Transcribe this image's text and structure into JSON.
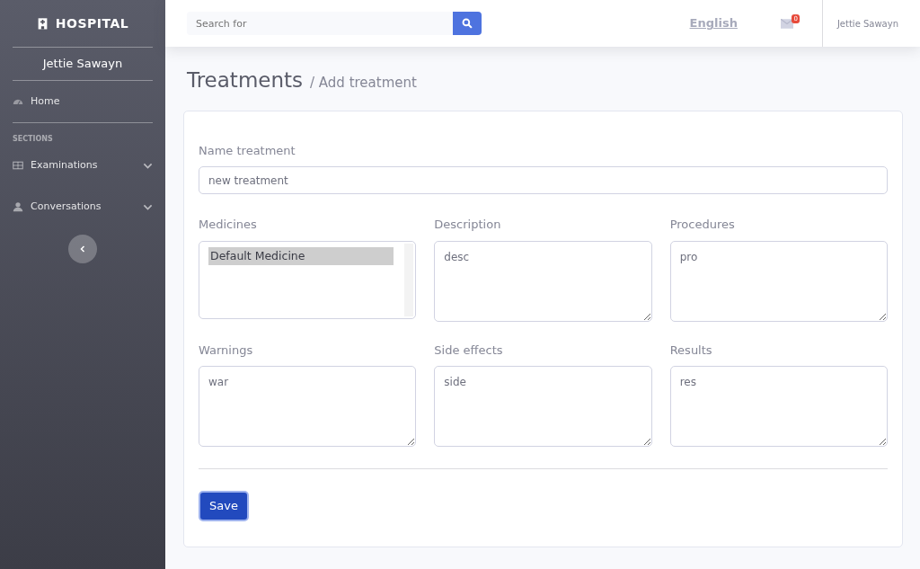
{
  "sidebar": {
    "brand": "HOSPITAL",
    "user": "Jettie Sawayn",
    "items": [
      {
        "kind": "link",
        "label": "Home"
      },
      {
        "kind": "heading",
        "label": "SECTIONS"
      },
      {
        "kind": "group",
        "label": "Examinations",
        "expanded": false
      },
      {
        "kind": "group",
        "label": "Conversations",
        "expanded": false
      }
    ]
  },
  "topbar": {
    "search": {
      "placeholder": "Search for"
    },
    "language": "English",
    "messages_badge": "0",
    "user": "Jettie Sawayn"
  },
  "page": {
    "title": "Treatments",
    "subtitle": "/ Add treatment"
  },
  "form": {
    "name": {
      "label": "Name treatment",
      "value": "new treatment"
    },
    "medicines": {
      "label": "Medicines",
      "options": [
        {
          "label": "Default Medicine",
          "selected": true
        }
      ]
    },
    "fields": [
      {
        "label": "Description",
        "value": "desc"
      },
      {
        "label": "Procedures",
        "value": "pro"
      },
      {
        "label": "Warnings",
        "value": "war"
      },
      {
        "label": "Side effects",
        "value": "side"
      },
      {
        "label": "Results",
        "value": "res"
      }
    ],
    "save": "Save"
  }
}
